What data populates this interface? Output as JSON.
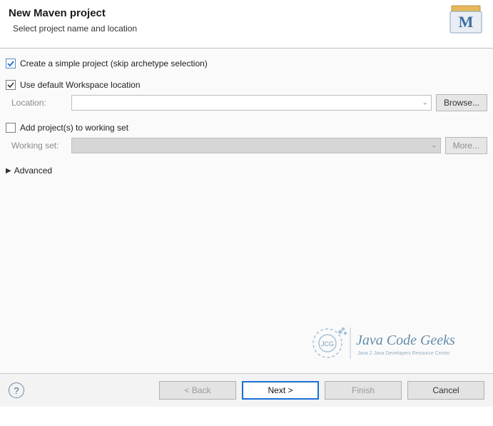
{
  "header": {
    "title": "New Maven project",
    "subtitle": "Select project name and location"
  },
  "options": {
    "simple_project_label": "Create a simple project (skip archetype selection)",
    "simple_project_checked": true,
    "use_default_workspace_label": "Use default Workspace location",
    "use_default_workspace_checked": true,
    "location_label": "Location:",
    "location_value": "",
    "browse_label": "Browse...",
    "add_to_working_set_label": "Add project(s) to working set",
    "add_to_working_set_checked": false,
    "working_set_label": "Working set:",
    "working_set_value": "",
    "more_label": "More...",
    "advanced_label": "Advanced"
  },
  "watermark": {
    "brand_main": "Java Code Geeks",
    "brand_sub": "Java 2 Java Developers Resource Center"
  },
  "footer": {
    "back": "< Back",
    "next": "Next >",
    "finish": "Finish",
    "cancel": "Cancel"
  }
}
